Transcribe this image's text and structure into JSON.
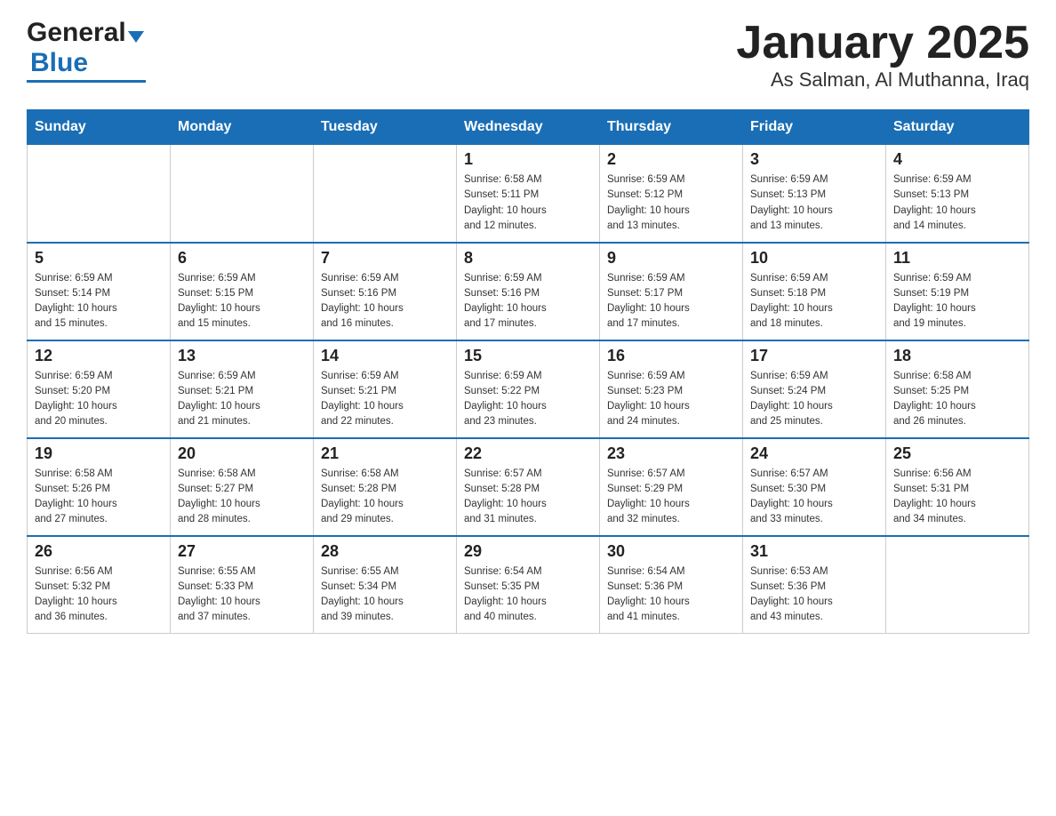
{
  "header": {
    "logo_general": "General",
    "logo_blue": "Blue",
    "title": "January 2025",
    "subtitle": "As Salman, Al Muthanna, Iraq"
  },
  "days_of_week": [
    "Sunday",
    "Monday",
    "Tuesday",
    "Wednesday",
    "Thursday",
    "Friday",
    "Saturday"
  ],
  "weeks": [
    [
      {
        "num": "",
        "info": ""
      },
      {
        "num": "",
        "info": ""
      },
      {
        "num": "",
        "info": ""
      },
      {
        "num": "1",
        "info": "Sunrise: 6:58 AM\nSunset: 5:11 PM\nDaylight: 10 hours\nand 12 minutes."
      },
      {
        "num": "2",
        "info": "Sunrise: 6:59 AM\nSunset: 5:12 PM\nDaylight: 10 hours\nand 13 minutes."
      },
      {
        "num": "3",
        "info": "Sunrise: 6:59 AM\nSunset: 5:13 PM\nDaylight: 10 hours\nand 13 minutes."
      },
      {
        "num": "4",
        "info": "Sunrise: 6:59 AM\nSunset: 5:13 PM\nDaylight: 10 hours\nand 14 minutes."
      }
    ],
    [
      {
        "num": "5",
        "info": "Sunrise: 6:59 AM\nSunset: 5:14 PM\nDaylight: 10 hours\nand 15 minutes."
      },
      {
        "num": "6",
        "info": "Sunrise: 6:59 AM\nSunset: 5:15 PM\nDaylight: 10 hours\nand 15 minutes."
      },
      {
        "num": "7",
        "info": "Sunrise: 6:59 AM\nSunset: 5:16 PM\nDaylight: 10 hours\nand 16 minutes."
      },
      {
        "num": "8",
        "info": "Sunrise: 6:59 AM\nSunset: 5:16 PM\nDaylight: 10 hours\nand 17 minutes."
      },
      {
        "num": "9",
        "info": "Sunrise: 6:59 AM\nSunset: 5:17 PM\nDaylight: 10 hours\nand 17 minutes."
      },
      {
        "num": "10",
        "info": "Sunrise: 6:59 AM\nSunset: 5:18 PM\nDaylight: 10 hours\nand 18 minutes."
      },
      {
        "num": "11",
        "info": "Sunrise: 6:59 AM\nSunset: 5:19 PM\nDaylight: 10 hours\nand 19 minutes."
      }
    ],
    [
      {
        "num": "12",
        "info": "Sunrise: 6:59 AM\nSunset: 5:20 PM\nDaylight: 10 hours\nand 20 minutes."
      },
      {
        "num": "13",
        "info": "Sunrise: 6:59 AM\nSunset: 5:21 PM\nDaylight: 10 hours\nand 21 minutes."
      },
      {
        "num": "14",
        "info": "Sunrise: 6:59 AM\nSunset: 5:21 PM\nDaylight: 10 hours\nand 22 minutes."
      },
      {
        "num": "15",
        "info": "Sunrise: 6:59 AM\nSunset: 5:22 PM\nDaylight: 10 hours\nand 23 minutes."
      },
      {
        "num": "16",
        "info": "Sunrise: 6:59 AM\nSunset: 5:23 PM\nDaylight: 10 hours\nand 24 minutes."
      },
      {
        "num": "17",
        "info": "Sunrise: 6:59 AM\nSunset: 5:24 PM\nDaylight: 10 hours\nand 25 minutes."
      },
      {
        "num": "18",
        "info": "Sunrise: 6:58 AM\nSunset: 5:25 PM\nDaylight: 10 hours\nand 26 minutes."
      }
    ],
    [
      {
        "num": "19",
        "info": "Sunrise: 6:58 AM\nSunset: 5:26 PM\nDaylight: 10 hours\nand 27 minutes."
      },
      {
        "num": "20",
        "info": "Sunrise: 6:58 AM\nSunset: 5:27 PM\nDaylight: 10 hours\nand 28 minutes."
      },
      {
        "num": "21",
        "info": "Sunrise: 6:58 AM\nSunset: 5:28 PM\nDaylight: 10 hours\nand 29 minutes."
      },
      {
        "num": "22",
        "info": "Sunrise: 6:57 AM\nSunset: 5:28 PM\nDaylight: 10 hours\nand 31 minutes."
      },
      {
        "num": "23",
        "info": "Sunrise: 6:57 AM\nSunset: 5:29 PM\nDaylight: 10 hours\nand 32 minutes."
      },
      {
        "num": "24",
        "info": "Sunrise: 6:57 AM\nSunset: 5:30 PM\nDaylight: 10 hours\nand 33 minutes."
      },
      {
        "num": "25",
        "info": "Sunrise: 6:56 AM\nSunset: 5:31 PM\nDaylight: 10 hours\nand 34 minutes."
      }
    ],
    [
      {
        "num": "26",
        "info": "Sunrise: 6:56 AM\nSunset: 5:32 PM\nDaylight: 10 hours\nand 36 minutes."
      },
      {
        "num": "27",
        "info": "Sunrise: 6:55 AM\nSunset: 5:33 PM\nDaylight: 10 hours\nand 37 minutes."
      },
      {
        "num": "28",
        "info": "Sunrise: 6:55 AM\nSunset: 5:34 PM\nDaylight: 10 hours\nand 39 minutes."
      },
      {
        "num": "29",
        "info": "Sunrise: 6:54 AM\nSunset: 5:35 PM\nDaylight: 10 hours\nand 40 minutes."
      },
      {
        "num": "30",
        "info": "Sunrise: 6:54 AM\nSunset: 5:36 PM\nDaylight: 10 hours\nand 41 minutes."
      },
      {
        "num": "31",
        "info": "Sunrise: 6:53 AM\nSunset: 5:36 PM\nDaylight: 10 hours\nand 43 minutes."
      },
      {
        "num": "",
        "info": ""
      }
    ]
  ]
}
